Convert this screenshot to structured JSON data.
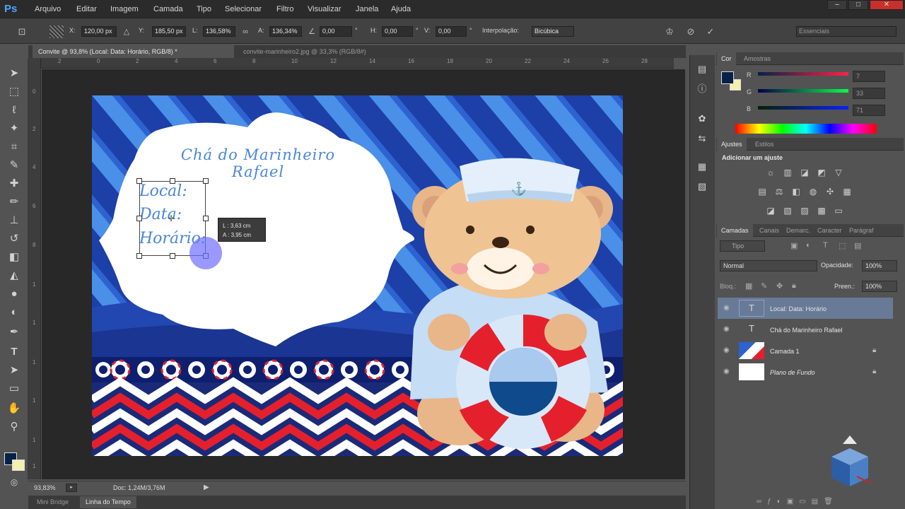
{
  "app": {
    "logo": "Ps"
  },
  "menu": [
    "Arquivo",
    "Editar",
    "Imagem",
    "Camada",
    "Tipo",
    "Selecionar",
    "Filtro",
    "Visualizar",
    "Janela",
    "Ajuda"
  ],
  "options": {
    "x_label": "X:",
    "x_value": "120,00 px",
    "y_label": "Y:",
    "y_value": "185,50 px",
    "w_label": "L:",
    "w_value": "136,58%",
    "h_label": "A:",
    "h_value": "136,34%",
    "angle_value": "0,00",
    "angle_unit": "°",
    "hskew_label": "H:",
    "hskew_value": "0,00",
    "hskew_unit": "°",
    "vskew_label": "V:",
    "vskew_value": "0,00",
    "vskew_unit": "°",
    "interp_label": "Interpolação:",
    "interp_value": "Bicúbica",
    "workspace": "Essenciais"
  },
  "tabs": [
    "Convite @ 93,8% (Local:  Data:  Horário, RGB/8) *",
    "convite-marinheiro2.jpg @ 33,3% (RGB/8#)"
  ],
  "ruler_top": [
    "2",
    "0",
    "2",
    "4",
    "6",
    "8",
    "10",
    "12",
    "14",
    "16",
    "18",
    "20",
    "22",
    "24",
    "26",
    "28"
  ],
  "ruler_left": [
    "0",
    "2",
    "4",
    "6",
    "8",
    "1",
    "1",
    "1",
    "1",
    "1",
    "1"
  ],
  "canvas": {
    "title": "Chá do Marinheiro Rafael",
    "line1": "Local:",
    "line2": "Data:",
    "line3": "Horário:",
    "tooltip_l": "L :  3,63 cm",
    "tooltip_a": "A :  3,95 cm"
  },
  "status": {
    "zoom": "93,83%",
    "doc": "Doc: 1,24M/3,76M"
  },
  "bottom_tabs": [
    "Mini Bridge",
    "Linha do Tempo"
  ],
  "color_panel": {
    "tabs": [
      "Cor",
      "Amostras"
    ],
    "r_label": "R",
    "r_value": "7",
    "g_label": "G",
    "g_value": "33",
    "b_label": "B",
    "b_value": "71",
    "foreground": "#072147",
    "background": "#f3f0b0"
  },
  "adjust_panel": {
    "tabs": [
      "Ajustes",
      "Estilos"
    ],
    "heading": "Adicionar um ajuste"
  },
  "layers_panel": {
    "tabs": [
      "Camadas",
      "Canais",
      "Demarc.",
      "Caracter",
      "Parágraf"
    ],
    "filter": "Tipo",
    "blend": "Normal",
    "opacity_label": "Opacidade:",
    "opacity_value": "100%",
    "lock_label": "Bloq.:",
    "fill_label": "Preen.:",
    "fill_value": "100%",
    "layers": [
      {
        "name": "Local:  Data:  Horário",
        "kind": "T"
      },
      {
        "name": "Chá do Marinheiro Rafael",
        "kind": "T"
      },
      {
        "name": "Camada 1",
        "kind": "img"
      },
      {
        "name": "Plano de Fundo",
        "kind": "bg"
      }
    ]
  }
}
